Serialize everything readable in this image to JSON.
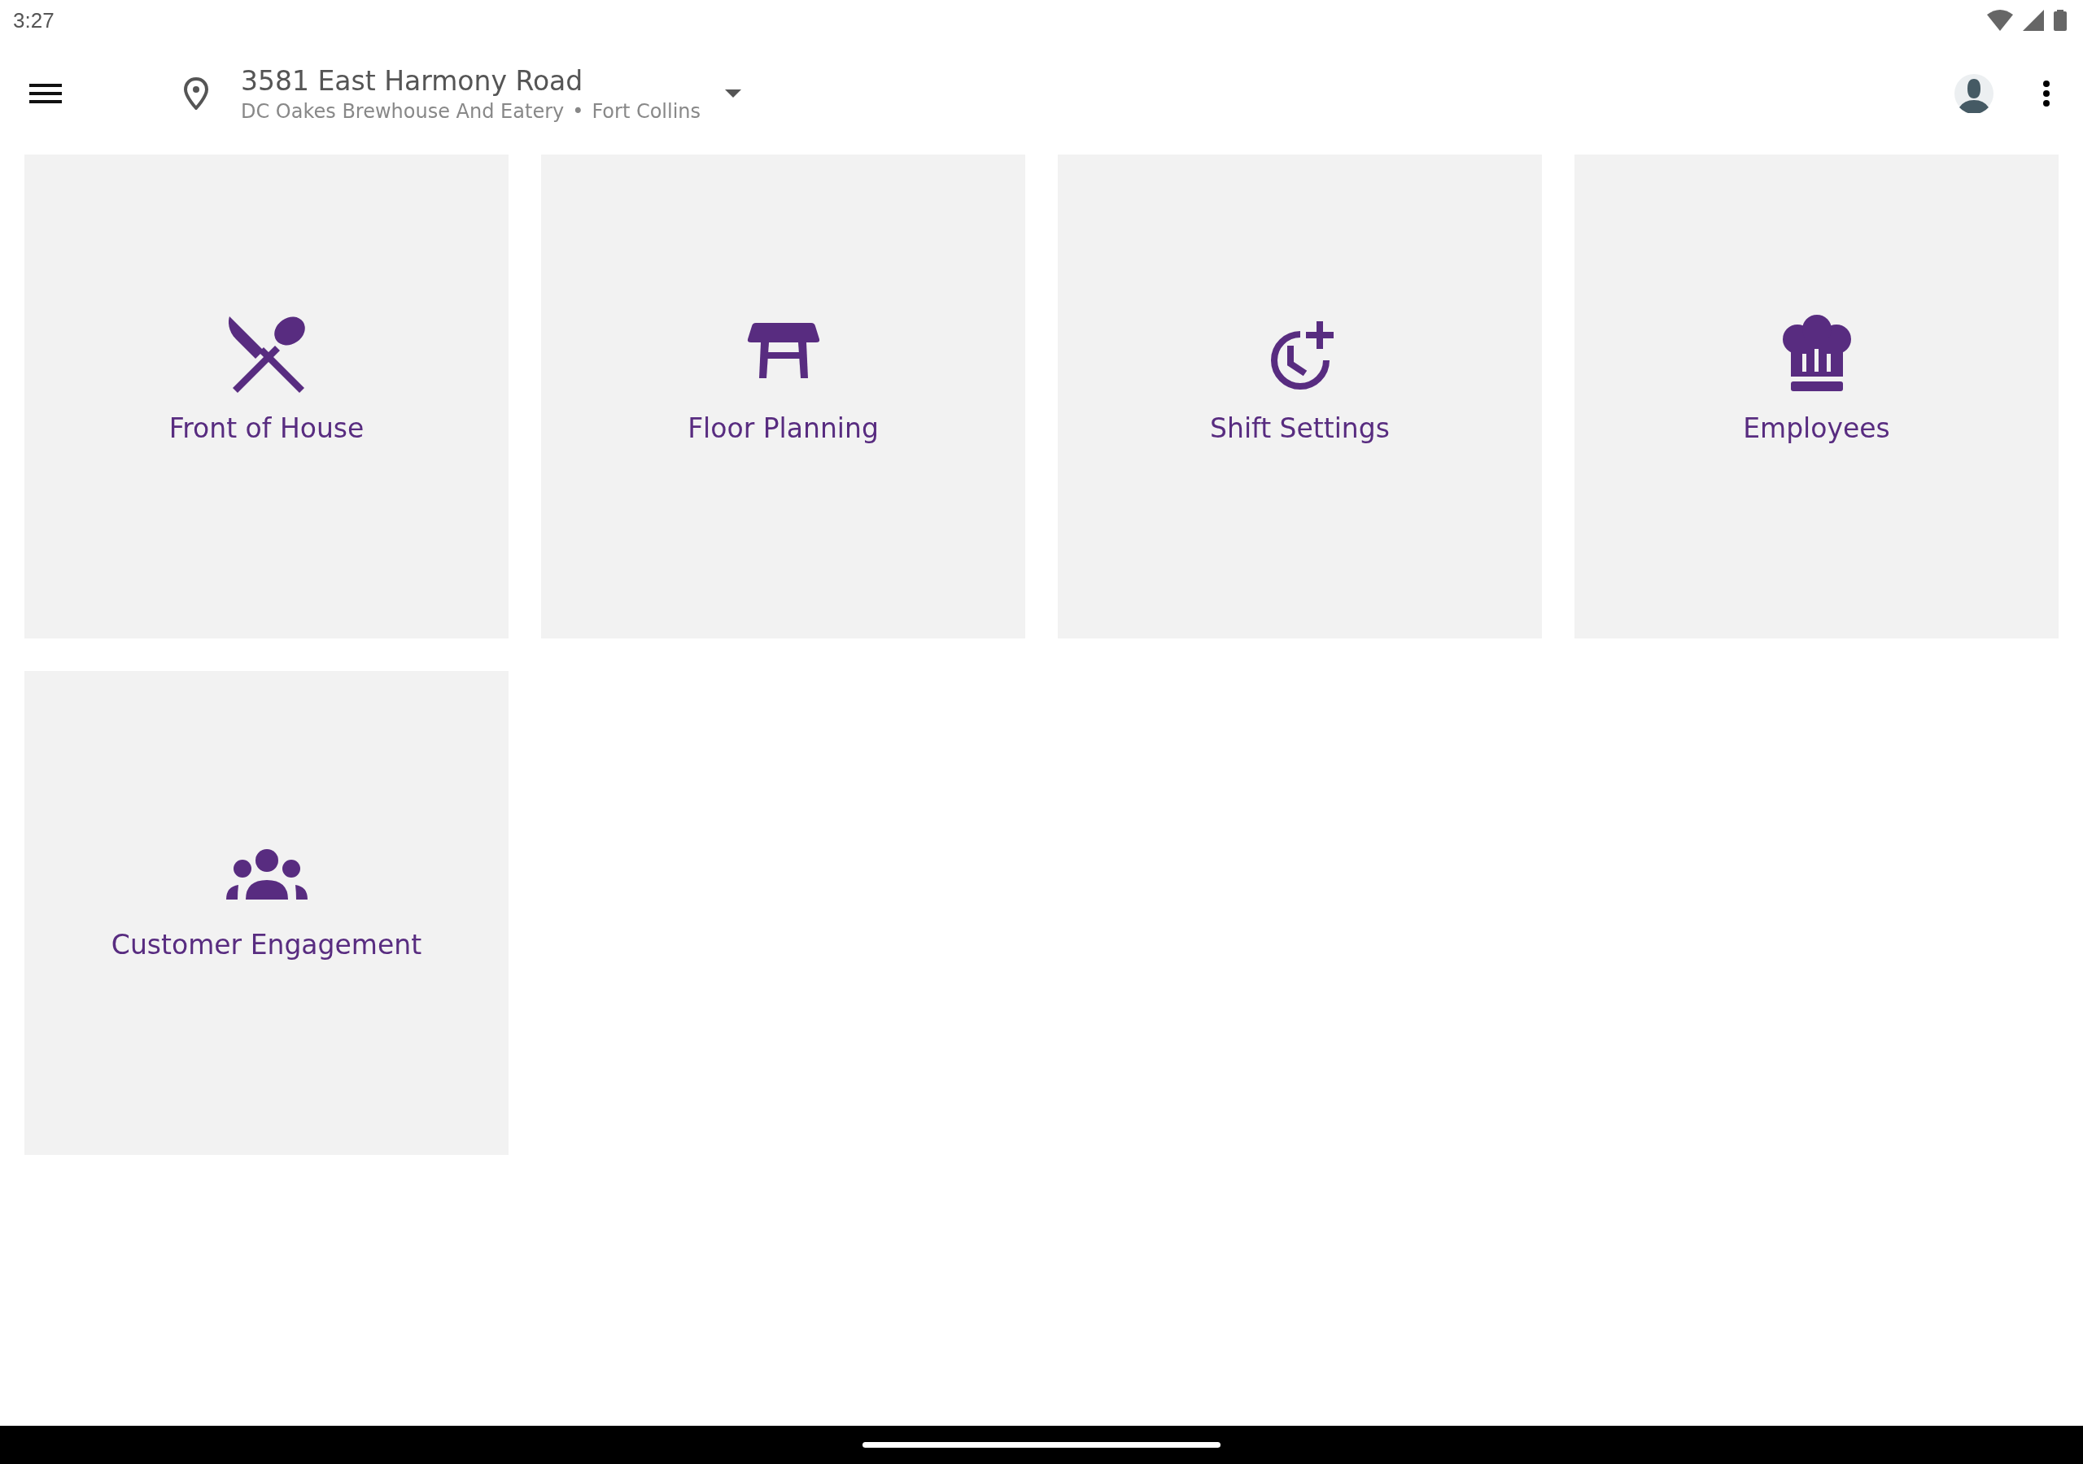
{
  "status_bar": {
    "time": "3:27"
  },
  "header": {
    "title": "3581 East Harmony Road",
    "venue": "DC Oakes Brewhouse And Eatery",
    "separator": "•",
    "city": "Fort Collins"
  },
  "tiles": [
    {
      "label": "Front of House",
      "kind": "utensils"
    },
    {
      "label": "Floor Planning",
      "kind": "table"
    },
    {
      "label": "Shift Settings",
      "kind": "clock_plus"
    },
    {
      "label": "Employees",
      "kind": "chef_hat"
    },
    {
      "label": "Customer Engagement",
      "kind": "people"
    }
  ]
}
